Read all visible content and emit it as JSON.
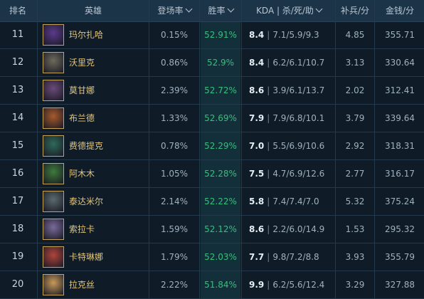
{
  "header": {
    "rank": "排名",
    "hero": "英雄",
    "pick_rate": "登场率",
    "win_rate": "胜率",
    "kda": "KDA | 杀/死/助",
    "cs": "补兵/分",
    "gold": "金钱/分"
  },
  "rows": [
    {
      "rank": "11",
      "name": "玛尔扎哈",
      "pick": "0.15%",
      "win": "52.91%",
      "kda": "8.4",
      "ksa": "7.1/5.9/9.3",
      "cs": "4.85",
      "gold": "355.71",
      "avatar_color": "#5b3a8c"
    },
    {
      "rank": "12",
      "name": "沃里克",
      "pick": "0.86%",
      "win": "52.9%",
      "kda": "8.4",
      "ksa": "6.2/6.1/10.7",
      "cs": "3.13",
      "gold": "330.64",
      "avatar_color": "#6d6a5c"
    },
    {
      "rank": "13",
      "name": "莫甘娜",
      "pick": "2.39%",
      "win": "52.72%",
      "kda": "8.6",
      "ksa": "3.9/6.1/13.7",
      "cs": "2.02",
      "gold": "312.41",
      "avatar_color": "#6a4a7a"
    },
    {
      "rank": "14",
      "name": "布兰德",
      "pick": "1.33%",
      "win": "52.69%",
      "kda": "7.9",
      "ksa": "7.9/6.8/10.1",
      "cs": "3.79",
      "gold": "339.64",
      "avatar_color": "#a85a2c"
    },
    {
      "rank": "15",
      "name": "费德提克",
      "pick": "0.78%",
      "win": "52.29%",
      "kda": "7.0",
      "ksa": "5.5/6.9/10.6",
      "cs": "2.92",
      "gold": "318.31",
      "avatar_color": "#2f6a5a"
    },
    {
      "rank": "16",
      "name": "阿木木",
      "pick": "1.05%",
      "win": "52.28%",
      "kda": "7.5",
      "ksa": "4.7/6.9/12.6",
      "cs": "2.77",
      "gold": "316.17",
      "avatar_color": "#3f7a3a"
    },
    {
      "rank": "17",
      "name": "泰达米尔",
      "pick": "2.14%",
      "win": "52.22%",
      "kda": "5.8",
      "ksa": "7.4/7.4/7.0",
      "cs": "5.32",
      "gold": "375.24",
      "avatar_color": "#5a6a6e"
    },
    {
      "rank": "18",
      "name": "索拉卡",
      "pick": "1.59%",
      "win": "52.12%",
      "kda": "8.6",
      "ksa": "2.2/6.0/14.9",
      "cs": "1.53",
      "gold": "295.32",
      "avatar_color": "#7a6a9a"
    },
    {
      "rank": "19",
      "name": "卡特琳娜",
      "pick": "1.79%",
      "win": "52.03%",
      "kda": "7.7",
      "ksa": "9.8/7.2/8.8",
      "cs": "3.93",
      "gold": "355.79",
      "avatar_color": "#b0443a"
    },
    {
      "rank": "20",
      "name": "拉克丝",
      "pick": "2.22%",
      "win": "51.84%",
      "kda": "9.9",
      "ksa": "6.2/5.6/12.4",
      "cs": "3.29",
      "gold": "327.88",
      "avatar_color": "#c89a5a"
    }
  ],
  "colors": {
    "accent_win": "#34c07a",
    "name_gold": "#e3c57a"
  }
}
